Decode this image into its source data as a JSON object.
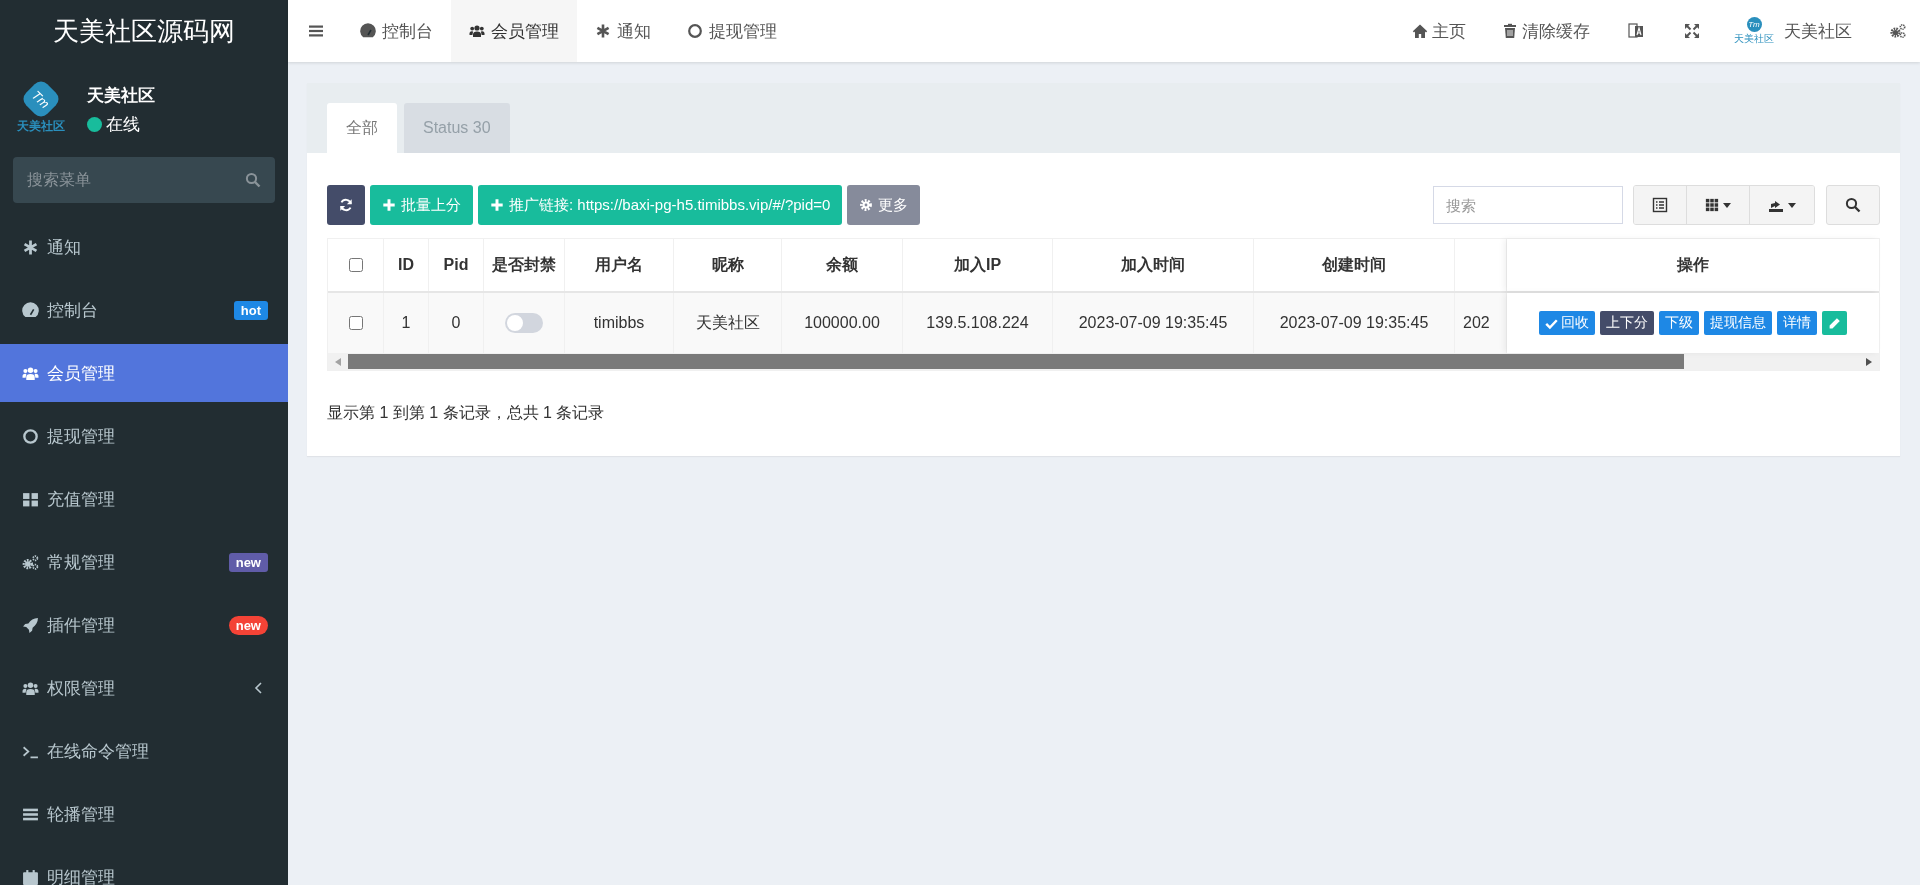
{
  "brand": {
    "title": "天美社区源码网"
  },
  "user": {
    "logo": {
      "mark": "Tm",
      "caption": "天美社区"
    },
    "name": "天美社区",
    "status": "在线",
    "online": true
  },
  "sidebar": {
    "search": {
      "placeholder": "搜索菜单"
    },
    "items": [
      {
        "label": "通知",
        "selected": false
      },
      {
        "label": "控制台",
        "selected": false,
        "badge": {
          "text": "hot",
          "color": "#1e88e5"
        }
      },
      {
        "label": "会员管理",
        "selected": true
      },
      {
        "label": "提现管理",
        "selected": false
      },
      {
        "label": "充值管理",
        "selected": false
      },
      {
        "label": "常规管理",
        "selected": false,
        "badge": {
          "text": "new",
          "color": "#605ca8"
        }
      },
      {
        "label": "插件管理",
        "selected": false,
        "badge": {
          "text": "new",
          "color": "#f44336"
        }
      },
      {
        "label": "权限管理",
        "selected": false,
        "expanded": false
      },
      {
        "label": "在线命令管理",
        "selected": false
      },
      {
        "label": "轮播管理",
        "selected": false
      },
      {
        "label": "明细管理",
        "selected": false
      }
    ]
  },
  "top_tabs": [
    {
      "label": "控制台",
      "selected": false
    },
    {
      "label": "会员管理",
      "selected": true
    },
    {
      "label": "通知",
      "selected": false
    },
    {
      "label": "提现管理",
      "selected": false
    }
  ],
  "header_right": {
    "home": "主页",
    "clear_cache": "清除缓存",
    "logo": {
      "mark": "Tm",
      "caption": "天美社区"
    },
    "username": "天美社区"
  },
  "panel_tabs": [
    {
      "label": "全部",
      "selected": true
    },
    {
      "label": "Status 30",
      "selected": false
    }
  ],
  "toolbar": {
    "buttons": [
      {
        "label": "批量上分",
        "kind": "add"
      },
      {
        "label": "推广链接: https://baxi-pg-h5.timibbs.vip/#/?pid=0",
        "kind": "add"
      },
      {
        "label": "更多",
        "kind": "more"
      }
    ],
    "search": {
      "placeholder": "搜索"
    }
  },
  "table": {
    "select_all": {
      "checked": false
    },
    "columns": [
      "ID",
      "Pid",
      "是否封禁",
      "用户名",
      "昵称",
      "余额",
      "加入IP",
      "加入时间",
      "创建时间"
    ],
    "action_column": "操作",
    "rows": [
      {
        "checked": false,
        "id": "1",
        "pid": "0",
        "banned": false,
        "username": "timibbs",
        "nickname": "天美社区",
        "balance": "100000.00",
        "join_ip": "139.5.108.224",
        "join_time": "2023-07-09 19:35:45",
        "create_time": "2023-07-09 19:35:45",
        "column_10": "202",
        "actions": [
          {
            "kind": "check",
            "label": "回收",
            "color": "#1e88e5"
          },
          {
            "kind": "text",
            "label": "上下分",
            "color": "#444c69"
          },
          {
            "kind": "text",
            "label": "下级",
            "color": "#1e88e5"
          },
          {
            "kind": "text",
            "label": "提现信息",
            "color": "#1e88e5"
          },
          {
            "kind": "text",
            "label": "详情",
            "color": "#1e88e5"
          },
          {
            "kind": "edit",
            "color": "#18bc9c"
          }
        ]
      }
    ]
  },
  "footer": "显示第 1 到第 1 条记录，总共 1 条记录"
}
